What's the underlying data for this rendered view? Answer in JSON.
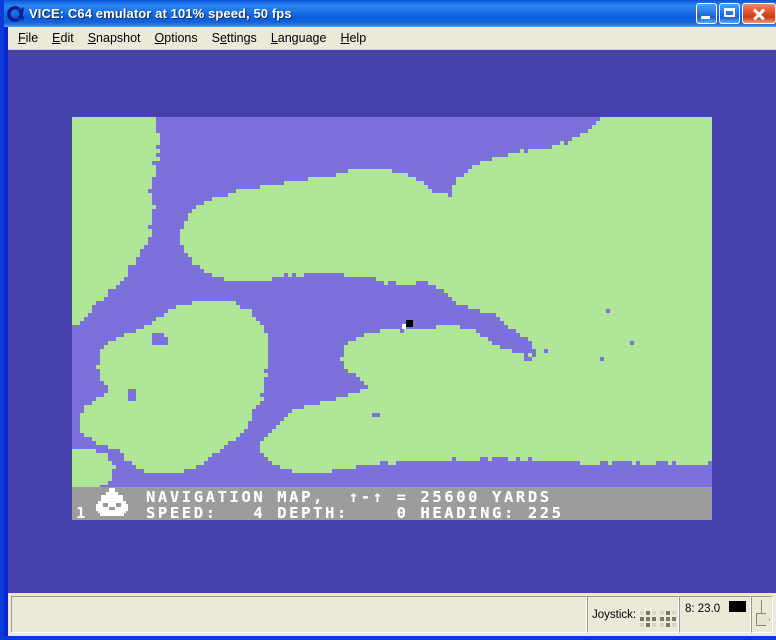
{
  "window": {
    "title": "VICE: C64 emulator at 101% speed, 50 fps",
    "icon": "vice-commodore-icon",
    "controls": {
      "minimize": "minimize-button",
      "maximize": "maximize-button",
      "close": "close-button"
    }
  },
  "menubar": {
    "items": [
      {
        "label": "File",
        "accel": "F"
      },
      {
        "label": "Edit",
        "accel": "E"
      },
      {
        "label": "Snapshot",
        "accel": "S"
      },
      {
        "label": "Options",
        "accel": "O"
      },
      {
        "label": "Settings",
        "accel": "e"
      },
      {
        "label": "Language",
        "accel": "L"
      },
      {
        "label": "Help",
        "accel": "H"
      }
    ]
  },
  "emulator": {
    "border_color": "#4640ac",
    "screen": {
      "water_color": "#7c70da",
      "land_color": "#aee596",
      "marker_color": "#000000",
      "hud_background": "#9c9c9c",
      "hud_text_color": "#ffffff"
    },
    "hud": {
      "line1": "NAVIGATION MAP,  ↑-↑ = 25600 YARDS",
      "line2": "SPEED:   4 DEPTH:    0 HEADING: 225",
      "title": "NAVIGATION MAP,",
      "scale_label": "↑-↑ = 25600 YARDS",
      "scale_value": "25600",
      "scale_units": "YARDS",
      "speed_label": "SPEED:",
      "speed_value": "4",
      "depth_label": "DEPTH:",
      "depth_value": "0",
      "heading_label": "HEADING:",
      "heading_value": "225",
      "sub_count": "1",
      "sub_icon": "submarine-icon"
    }
  },
  "statusbar": {
    "left_panel": "",
    "joystick_label": "Joystick:",
    "joystick_ports": [
      {
        "port": 1,
        "dots": [
          0,
          0,
          0,
          0,
          0,
          0,
          0,
          0,
          0
        ]
      },
      {
        "port": 2,
        "dots": [
          0,
          0,
          0,
          0,
          0,
          0,
          0,
          0,
          0
        ]
      }
    ],
    "drive": {
      "text": "8: 23.0",
      "number": "8",
      "track": "23.0",
      "led_color": "#000000"
    },
    "resize_grip": "resize-grip"
  },
  "chart_data": {
    "type": "heatmap",
    "title": "C64 Navigation Map",
    "note": "Pixel coastline map: land masses over water, player marker at map center-right"
  }
}
